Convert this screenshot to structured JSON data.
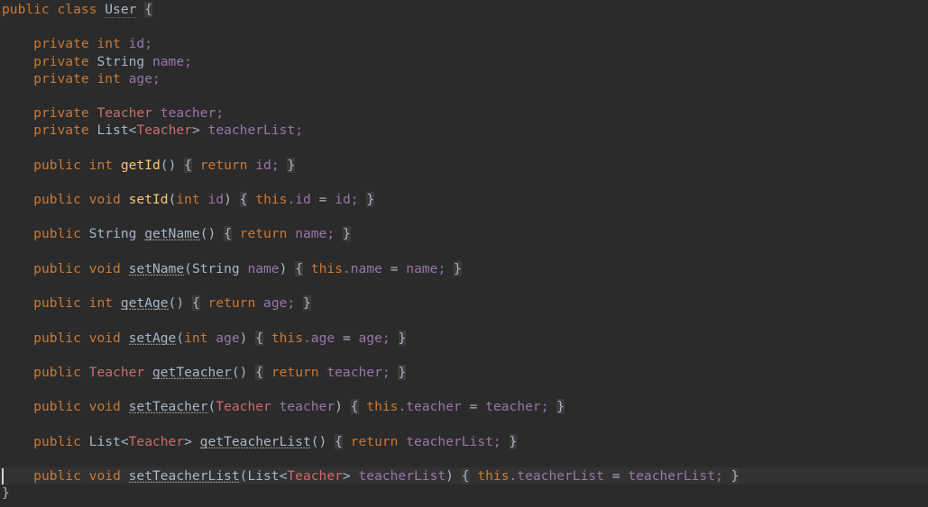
{
  "editor": {
    "language": "Java",
    "theme": "Darcula",
    "background_color": "#2b2b2b",
    "current_line_color": "#323232",
    "caret_color": "#d6d6d6",
    "colors": {
      "keyword": "#cc7832",
      "field": "#9876aa",
      "method_declaration": "#ffc66d",
      "unused_method": "#a9b7c6",
      "class_type": "#cf6a6a",
      "default_text": "#a9b7c6",
      "brace_highlight": "#3b3b3b"
    },
    "caret": {
      "line": 23,
      "column": 0
    }
  },
  "code": {
    "lines": [
      {
        "n": 1,
        "text": "public class User {"
      },
      {
        "n": 2,
        "text": ""
      },
      {
        "n": 3,
        "text": "    private int id;"
      },
      {
        "n": 4,
        "text": "    private String name;"
      },
      {
        "n": 5,
        "text": "    private int age;"
      },
      {
        "n": 6,
        "text": ""
      },
      {
        "n": 7,
        "text": "    private Teacher teacher;"
      },
      {
        "n": 8,
        "text": "    private List<Teacher> teacherList;"
      },
      {
        "n": 9,
        "text": ""
      },
      {
        "n": 10,
        "text": "    public int getId() { return id; }"
      },
      {
        "n": 11,
        "text": ""
      },
      {
        "n": 12,
        "text": "    public void setId(int id) { this.id = id; }"
      },
      {
        "n": 13,
        "text": ""
      },
      {
        "n": 14,
        "text": "    public String getName() { return name; }"
      },
      {
        "n": 15,
        "text": ""
      },
      {
        "n": 16,
        "text": "    public void setName(String name) { this.name = name; }"
      },
      {
        "n": 17,
        "text": ""
      },
      {
        "n": 18,
        "text": "    public int getAge() { return age; }"
      },
      {
        "n": 19,
        "text": ""
      },
      {
        "n": 20,
        "text": "    public void setAge(int age) { this.age = age; }"
      },
      {
        "n": 21,
        "text": ""
      },
      {
        "n": 22,
        "text": "    public Teacher getTeacher() { return teacher; }"
      },
      {
        "n": 23,
        "text": ""
      },
      {
        "n": 24,
        "text": "    public void setTeacher(Teacher teacher) { this.teacher = teacher; }"
      },
      {
        "n": 25,
        "text": ""
      },
      {
        "n": 26,
        "text": "    public List<Teacher> getTeacherList() { return teacherList; }"
      },
      {
        "n": 27,
        "text": ""
      },
      {
        "n": 28,
        "text": "    public void setTeacherList(List<Teacher> teacherList) { this.teacherList = teacherList; }"
      },
      {
        "n": 29,
        "text": "}"
      }
    ],
    "tokens": {
      "l1": [
        "public",
        "class",
        "User",
        "{"
      ],
      "l3": [
        "private",
        "int",
        "id",
        ";"
      ],
      "l4": [
        "private",
        "String",
        "name",
        ";"
      ],
      "l5": [
        "private",
        "int",
        "age",
        ";"
      ],
      "l7": [
        "private",
        "Teacher",
        "teacher",
        ";"
      ],
      "l8": [
        "private",
        "List",
        "<",
        "Teacher",
        ">",
        "teacherList",
        ";"
      ],
      "l10": [
        "public",
        "int",
        "getId",
        "()",
        "{",
        "return",
        "id;",
        "}"
      ],
      "l12": [
        "public",
        "void",
        "setId",
        "(",
        "int",
        "id",
        ")",
        "{",
        "this",
        ".id",
        "=",
        "id;",
        "}"
      ],
      "l14": [
        "public",
        "String",
        "getName",
        "()",
        "{",
        "return",
        "name;",
        "}"
      ],
      "l16": [
        "public",
        "void",
        "setName",
        "(",
        "String",
        "name",
        ")",
        "{",
        "this",
        ".name",
        "=",
        "name;",
        "}"
      ],
      "l18": [
        "public",
        "int",
        "getAge",
        "()",
        "{",
        "return",
        "age;",
        "}"
      ],
      "l20": [
        "public",
        "void",
        "setAge",
        "(",
        "int",
        "age",
        ")",
        "{",
        "this",
        ".age",
        "=",
        "age;",
        "}"
      ],
      "l22": [
        "public",
        "Teacher",
        "getTeacher",
        "()",
        "{",
        "return",
        "teacher;",
        "}"
      ],
      "l24": [
        "public",
        "void",
        "setTeacher",
        "(",
        "Teacher",
        "teacher",
        ")",
        "{",
        "this",
        ".teacher",
        "=",
        "teacher;",
        "}"
      ],
      "l26": [
        "public",
        "List",
        "<",
        "Teacher",
        ">",
        "getTeacherList",
        "()",
        "{",
        "return",
        "teacherList;",
        "}"
      ],
      "l28": [
        "public",
        "void",
        "setTeacherList",
        "(",
        "List",
        "<",
        "Teacher",
        ">",
        "teacherList",
        ")",
        "{",
        "this",
        ".teacherList",
        "=",
        "teacherList;",
        "}"
      ],
      "l29": [
        "}"
      ]
    },
    "keywords": {
      "public": "public",
      "class": "class",
      "private": "private",
      "int": "int",
      "void": "void",
      "return": "return",
      "this": "this"
    },
    "identifiers": {
      "user": "User",
      "string": "String",
      "list": "List",
      "teacher_type": "Teacher",
      "id": "id",
      "name": "name",
      "age": "age",
      "teacher": "teacher",
      "teacher_list": "teacherList",
      "get_id": "getId",
      "set_id": "setId",
      "get_name": "getName",
      "set_name": "setName",
      "get_age": "getAge",
      "set_age": "setAge",
      "get_teacher": "getTeacher",
      "set_teacher": "setTeacher",
      "get_teacher_list": "getTeacherList",
      "set_teacher_list": "setTeacherList"
    },
    "punct": {
      "semi": ";",
      "lparen": "(",
      "rparen": ")",
      "lbrace": "{",
      "rbrace": "}",
      "lt": "<",
      "gt": ">",
      "eq": "=",
      "dot": ".",
      "space": " ",
      "indent": "    "
    }
  }
}
